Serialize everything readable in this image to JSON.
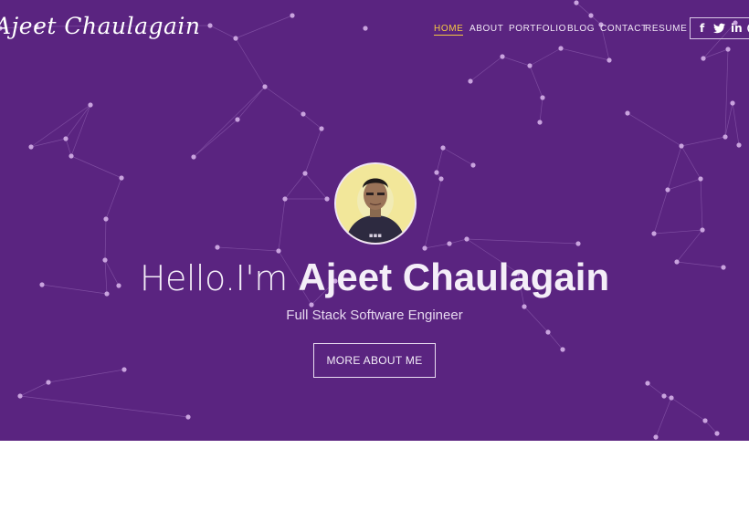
{
  "site": {
    "logo_text": "Ajeet Chaulagain"
  },
  "nav": {
    "items": [
      {
        "label": "HOME",
        "active": true
      },
      {
        "label": "ABOUT",
        "active": false
      },
      {
        "label": "PORTFOLIO",
        "active": false
      },
      {
        "label": "BLOG",
        "active": false
      },
      {
        "label": "CONTACT",
        "active": false
      },
      {
        "label": "RESUME",
        "active": false
      }
    ]
  },
  "social": {
    "icons": [
      "facebook-icon",
      "twitter-icon",
      "linkedin-icon",
      "github-icon"
    ],
    "glyphs": {
      "facebook": "f",
      "linkedin": "in"
    }
  },
  "hero": {
    "greeting": "Hello.I'm ",
    "name": "Ajeet Chaulagain",
    "subtitle": "Full Stack Software Engineer",
    "cta_label": "MORE ABOUT ME",
    "background_color": "#5a2480"
  },
  "colors": {
    "accent": "#f5c842",
    "hero_bg": "#5a2480",
    "network": "#c9a3de"
  }
}
